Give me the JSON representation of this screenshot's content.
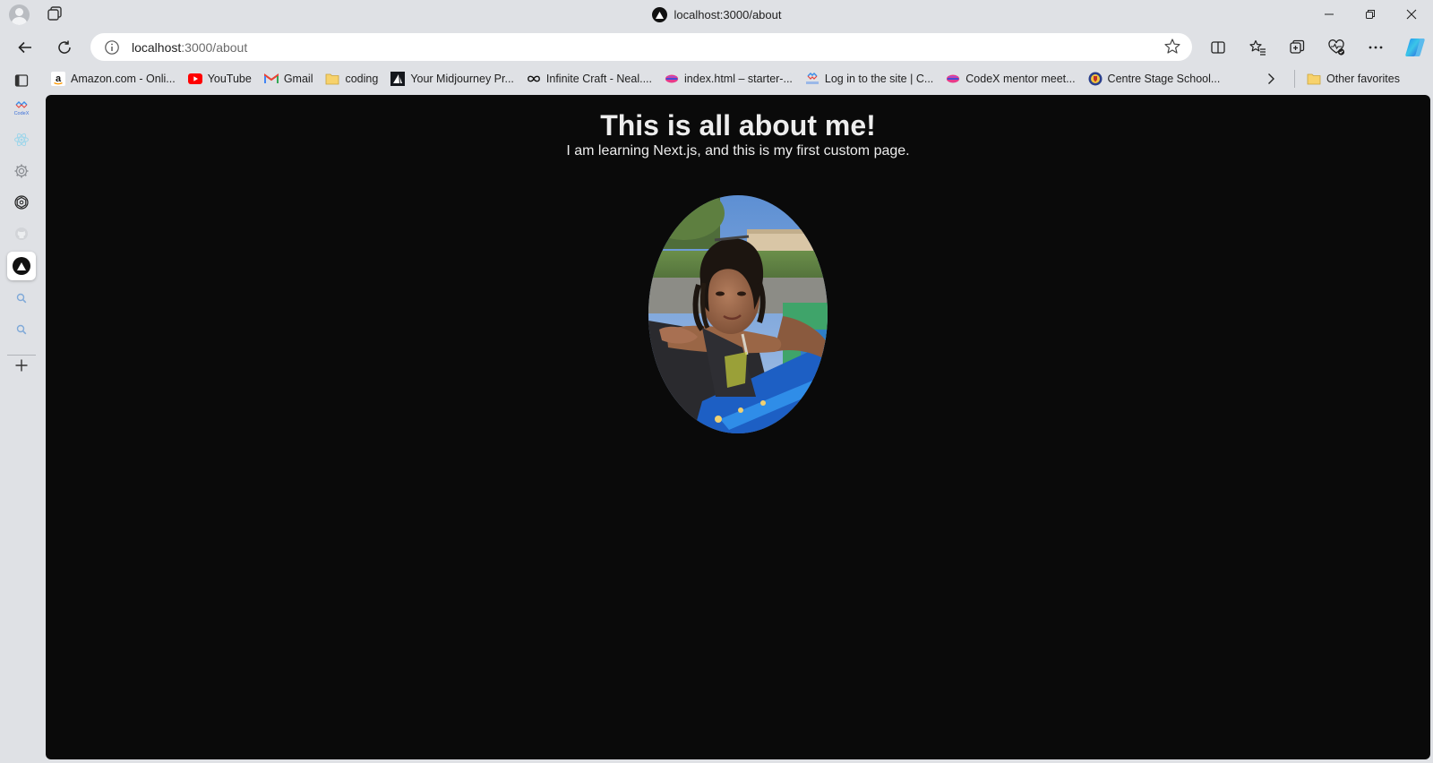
{
  "browser": {
    "tab_title": "localhost:3000/about",
    "url_host": "localhost",
    "url_path": ":3000/about"
  },
  "favorites": [
    {
      "label": "Amazon.com - Onli...",
      "icon": "amazon-icon"
    },
    {
      "label": "YouTube",
      "icon": "youtube-icon"
    },
    {
      "label": "Gmail",
      "icon": "gmail-icon"
    },
    {
      "label": "coding",
      "icon": "folder-icon"
    },
    {
      "label": "Your Midjourney Pr...",
      "icon": "midjourney-icon"
    },
    {
      "label": "Infinite Craft - Neal....",
      "icon": "infinity-icon"
    },
    {
      "label": "index.html – starter-...",
      "icon": "codepen-icon"
    },
    {
      "label": "Log in to the site | C...",
      "icon": "codex-icon"
    },
    {
      "label": "CodeX mentor meet...",
      "icon": "codepen-icon"
    },
    {
      "label": "Centre Stage School...",
      "icon": "crest-icon"
    }
  ],
  "other_favorites": "Other favorites",
  "sidebar_codex_label": "CodeX",
  "page": {
    "title": "This is all about me!",
    "subtitle": "I am learning Next.js, and this is my first custom page."
  },
  "colors": {
    "page_background": "#0a0a0a",
    "page_text": "#ededed",
    "browser_chrome": "#dfe1e5"
  }
}
